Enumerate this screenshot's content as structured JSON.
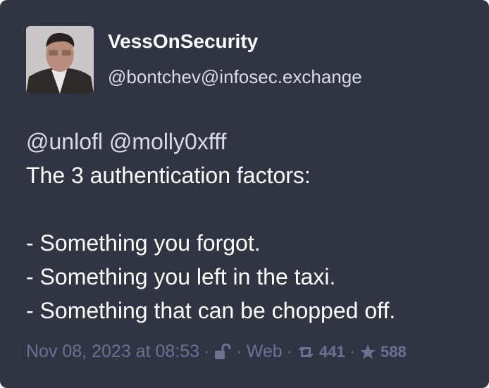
{
  "author": {
    "display_name": "VessOnSecurity",
    "handle": "@bontchev@infosec.exchange"
  },
  "post": {
    "mentions": [
      "@unlofl",
      "@molly0xfff"
    ],
    "lines": [
      "The 3 authentication factors:",
      "",
      "- Something you forgot.",
      "- Something you left in the taxi.",
      "- Something that can be chopped off."
    ]
  },
  "meta": {
    "timestamp": "Nov 08, 2023 at 08:53",
    "separator": "·",
    "visibility_icon": "unlocked-icon",
    "application": "Web",
    "boosts": "441",
    "favourites": "588"
  },
  "colors": {
    "background": "#313543",
    "meta": "#6d7293"
  }
}
